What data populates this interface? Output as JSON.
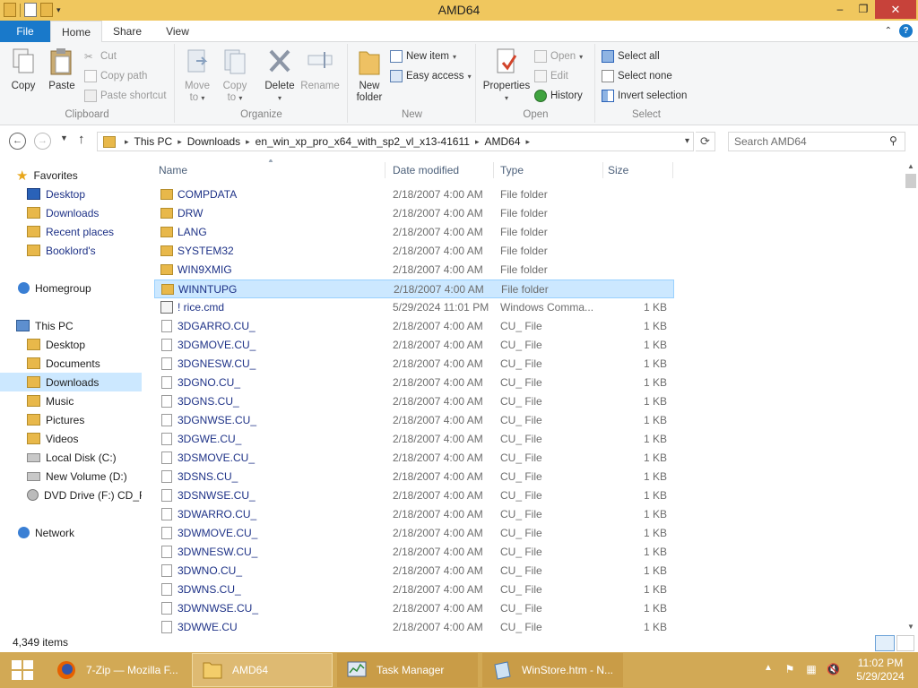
{
  "window": {
    "title": "AMD64",
    "min_glyph": "–",
    "max_glyph": "❐",
    "close_glyph": "✕"
  },
  "ribbon_tabs": {
    "file": "File",
    "home": "Home",
    "share": "Share",
    "view": "View"
  },
  "ribbon": {
    "clipboard": {
      "label": "Clipboard",
      "copy": "Copy",
      "paste": "Paste",
      "cut": "Cut",
      "copy_path": "Copy path",
      "paste_shortcut": "Paste shortcut"
    },
    "organize": {
      "label": "Organize",
      "move_to": "Move to",
      "copy_to": "Copy to",
      "delete": "Delete",
      "rename": "Rename"
    },
    "new": {
      "label": "New",
      "new_folder": "New folder",
      "new_item": "New item",
      "easy_access": "Easy access"
    },
    "open": {
      "label": "Open",
      "properties": "Properties",
      "open": "Open",
      "edit": "Edit",
      "history": "History"
    },
    "select": {
      "label": "Select",
      "select_all": "Select all",
      "select_none": "Select none",
      "invert_selection": "Invert selection"
    }
  },
  "address": {
    "breadcrumbs": [
      "This PC",
      "Downloads",
      "en_win_xp_pro_x64_with_sp2_vl_x13-41611",
      "AMD64"
    ],
    "search_placeholder": "Search AMD64"
  },
  "nav": {
    "favorites": "Favorites",
    "fav_items": [
      "Desktop",
      "Downloads",
      "Recent places",
      "Booklord's"
    ],
    "homegroup": "Homegroup",
    "this_pc": "This PC",
    "pc_items": [
      "Desktop",
      "Documents",
      "Downloads",
      "Music",
      "Pictures",
      "Videos",
      "Local Disk (C:)",
      "New Volume (D:)",
      "DVD Drive (F:) CD_R"
    ],
    "network": "Network"
  },
  "columns": {
    "name": "Name",
    "date": "Date modified",
    "type": "Type",
    "size": "Size"
  },
  "files": [
    {
      "name": "COMPDATA",
      "date": "2/18/2007 4:00 AM",
      "type": "File folder",
      "size": "",
      "kind": "folder"
    },
    {
      "name": "DRW",
      "date": "2/18/2007 4:00 AM",
      "type": "File folder",
      "size": "",
      "kind": "folder"
    },
    {
      "name": "LANG",
      "date": "2/18/2007 4:00 AM",
      "type": "File folder",
      "size": "",
      "kind": "folder"
    },
    {
      "name": "SYSTEM32",
      "date": "2/18/2007 4:00 AM",
      "type": "File folder",
      "size": "",
      "kind": "folder"
    },
    {
      "name": "WIN9XMIG",
      "date": "2/18/2007 4:00 AM",
      "type": "File folder",
      "size": "",
      "kind": "folder"
    },
    {
      "name": "WINNTUPG",
      "date": "2/18/2007 4:00 AM",
      "type": "File folder",
      "size": "",
      "kind": "folder",
      "selected": true
    },
    {
      "name": "! rice.cmd",
      "date": "5/29/2024 11:01 PM",
      "type": "Windows Comma...",
      "size": "1 KB",
      "kind": "cmd"
    },
    {
      "name": "3DGARRO.CU_",
      "date": "2/18/2007 4:00 AM",
      "type": "CU_ File",
      "size": "1 KB",
      "kind": "file"
    },
    {
      "name": "3DGMOVE.CU_",
      "date": "2/18/2007 4:00 AM",
      "type": "CU_ File",
      "size": "1 KB",
      "kind": "file"
    },
    {
      "name": "3DGNESW.CU_",
      "date": "2/18/2007 4:00 AM",
      "type": "CU_ File",
      "size": "1 KB",
      "kind": "file"
    },
    {
      "name": "3DGNO.CU_",
      "date": "2/18/2007 4:00 AM",
      "type": "CU_ File",
      "size": "1 KB",
      "kind": "file"
    },
    {
      "name": "3DGNS.CU_",
      "date": "2/18/2007 4:00 AM",
      "type": "CU_ File",
      "size": "1 KB",
      "kind": "file"
    },
    {
      "name": "3DGNWSE.CU_",
      "date": "2/18/2007 4:00 AM",
      "type": "CU_ File",
      "size": "1 KB",
      "kind": "file"
    },
    {
      "name": "3DGWE.CU_",
      "date": "2/18/2007 4:00 AM",
      "type": "CU_ File",
      "size": "1 KB",
      "kind": "file"
    },
    {
      "name": "3DSMOVE.CU_",
      "date": "2/18/2007 4:00 AM",
      "type": "CU_ File",
      "size": "1 KB",
      "kind": "file"
    },
    {
      "name": "3DSNS.CU_",
      "date": "2/18/2007 4:00 AM",
      "type": "CU_ File",
      "size": "1 KB",
      "kind": "file"
    },
    {
      "name": "3DSNWSE.CU_",
      "date": "2/18/2007 4:00 AM",
      "type": "CU_ File",
      "size": "1 KB",
      "kind": "file"
    },
    {
      "name": "3DWARRO.CU_",
      "date": "2/18/2007 4:00 AM",
      "type": "CU_ File",
      "size": "1 KB",
      "kind": "file"
    },
    {
      "name": "3DWMOVE.CU_",
      "date": "2/18/2007 4:00 AM",
      "type": "CU_ File",
      "size": "1 KB",
      "kind": "file"
    },
    {
      "name": "3DWNESW.CU_",
      "date": "2/18/2007 4:00 AM",
      "type": "CU_ File",
      "size": "1 KB",
      "kind": "file"
    },
    {
      "name": "3DWNO.CU_",
      "date": "2/18/2007 4:00 AM",
      "type": "CU_ File",
      "size": "1 KB",
      "kind": "file"
    },
    {
      "name": "3DWNS.CU_",
      "date": "2/18/2007 4:00 AM",
      "type": "CU_ File",
      "size": "1 KB",
      "kind": "file"
    },
    {
      "name": "3DWNWSE.CU_",
      "date": "2/18/2007 4:00 AM",
      "type": "CU_ File",
      "size": "1 KB",
      "kind": "file"
    },
    {
      "name": "3DWWE.CU",
      "date": "2/18/2007 4:00 AM",
      "type": "CU_ File",
      "size": "1 KB",
      "kind": "file"
    }
  ],
  "status": {
    "item_count": "4,349 items"
  },
  "taskbar": {
    "tasks": [
      "7-Zip — Mozilla F...",
      "AMD64",
      "Task Manager",
      "WinStore.htm - N..."
    ],
    "time": "11:02 PM",
    "date": "5/29/2024"
  },
  "colors": {
    "accent": "#1979ca",
    "selection": "#cce8ff",
    "taskbar": "#d2a955",
    "titlebar": "#f0c75e",
    "link_text": "#1e3287"
  }
}
